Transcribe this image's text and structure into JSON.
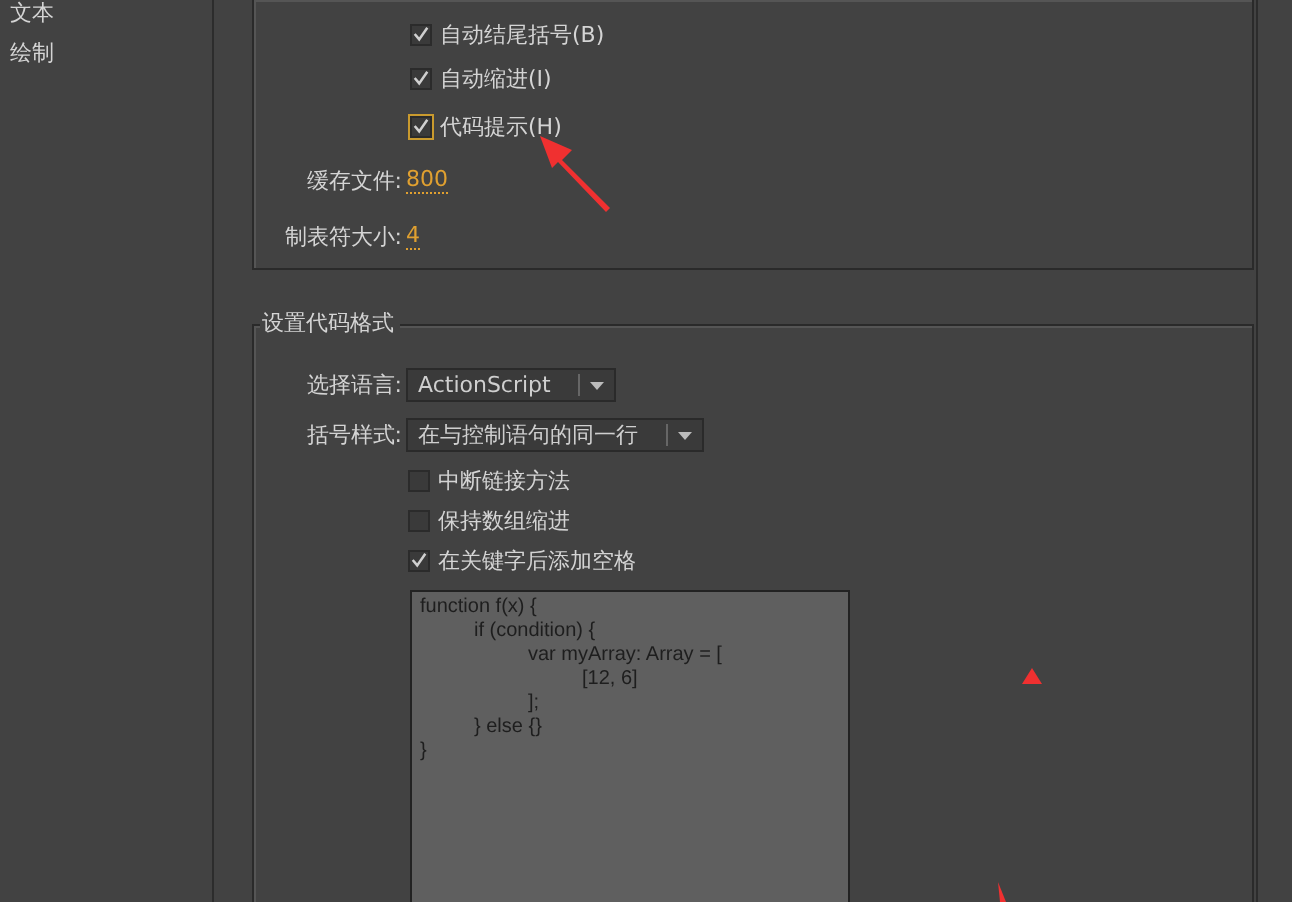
{
  "sidebar": {
    "items": [
      {
        "label": "文本",
        "selected": false
      },
      {
        "label": "绘制",
        "selected": false
      }
    ]
  },
  "editor_group": {
    "options": [
      {
        "label": "自动结尾括号(B)",
        "checked": true,
        "focused": false
      },
      {
        "label": "自动缩进(I)",
        "checked": true,
        "focused": false
      },
      {
        "label": "代码提示(H)",
        "checked": true,
        "focused": true
      }
    ],
    "fields": [
      {
        "label": "缓存文件:",
        "value": "800"
      },
      {
        "label": "制表符大小:",
        "value": "4"
      }
    ]
  },
  "format_group": {
    "title": "设置代码格式",
    "dropdowns": [
      {
        "label": "选择语言:",
        "value": "ActionScript"
      },
      {
        "label": "括号样式:",
        "value": "在与控制语句的同一行"
      }
    ],
    "options": [
      {
        "label": "中断链接方法",
        "checked": false
      },
      {
        "label": "保持数组缩进",
        "checked": false
      },
      {
        "label": "在关键字后添加空格",
        "checked": true
      }
    ],
    "preview_lines": [
      {
        "text": "function f(x) {",
        "children": [
          {
            "text": "if (condition) {",
            "children": [
              {
                "text": "var myArray: Array = [",
                "children": [
                  {
                    "text": "[12, 6]"
                  }
                ]
              },
              {
                "text": "];"
              }
            ]
          },
          {
            "text": "} else {}"
          }
        ]
      },
      {
        "text": "}"
      }
    ]
  }
}
